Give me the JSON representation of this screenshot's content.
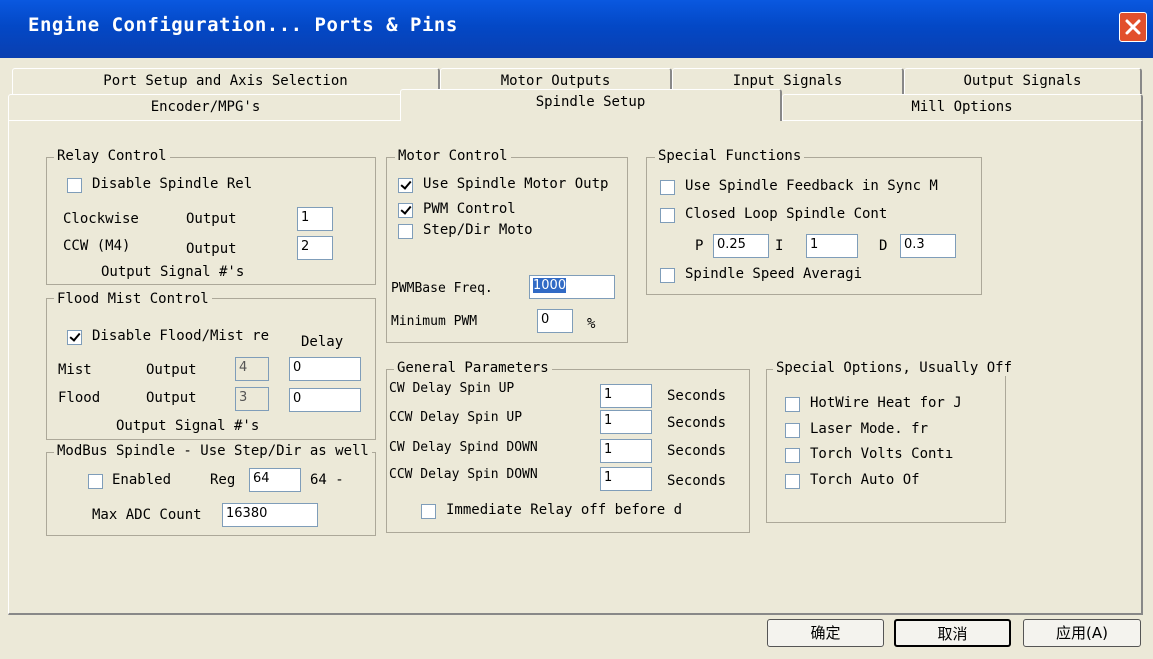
{
  "window": {
    "title": "Engine Configuration... Ports & Pins"
  },
  "tabs": {
    "row1": [
      "Port Setup and Axis Selection",
      "Motor Outputs",
      "Input Signals",
      "Output Signals"
    ],
    "row2": [
      "Encoder/MPG's",
      "Spindle Setup",
      "Mill Options"
    ],
    "active": "Spindle Setup"
  },
  "relay": {
    "title": "Relay Control",
    "disable_label": "Disable Spindle Rel",
    "cw_label": "Clockwise",
    "cw_output_label": "Output",
    "cw_value": "1",
    "ccw_label": "CCW (M4)",
    "ccw_output_label": "Output",
    "ccw_value": "2",
    "footer": "Output Signal #'s"
  },
  "flood": {
    "title": "Flood Mist Control",
    "disable_label": "Disable Flood/Mist re",
    "delay_label": "Delay",
    "mist_label": "Mist",
    "mist_output_label": "Output",
    "mist_value": "4",
    "mist_delay": "0",
    "flood_label": "Flood",
    "flood_output_label": "Output",
    "flood_value": "3",
    "flood_delay": "0",
    "footer": "Output Signal #'s"
  },
  "modbus": {
    "title": "ModBus Spindle - Use Step/Dir as well",
    "enabled_label": "Enabled",
    "reg_label": "Reg",
    "reg_value": "64",
    "reg_suffix": "64 -",
    "max_label": "Max ADC Count",
    "max_value": "16380"
  },
  "motor": {
    "title": "Motor Control",
    "use_spindle_label": "Use Spindle Motor Outp",
    "pwm_label": "PWM Control",
    "stepdir_label": "Step/Dir Moto",
    "pwm_base_label": "PWMBase Freq.",
    "pwm_base_value": "1000",
    "min_pwm_label": "Minimum PWM",
    "min_pwm_value": "0",
    "min_pwm_unit": "%"
  },
  "special": {
    "title": "Special Functions",
    "feedback_label": "Use Spindle Feedback in Sync M",
    "closed_loop_label": "Closed Loop Spindle Cont",
    "p_label": "P",
    "p_value": "0.25",
    "i_label": "I",
    "i_value": "1",
    "d_label": "D",
    "d_value": "0.3",
    "averaging_label": "Spindle Speed Averagi"
  },
  "general": {
    "title": "General Parameters",
    "rows": [
      {
        "label": "CW Delay Spin UP",
        "value": "1",
        "unit": "Seconds"
      },
      {
        "label": "CCW Delay Spin UP",
        "value": "1",
        "unit": "Seconds"
      },
      {
        "label": "CW Delay Spind DOWN",
        "value": "1",
        "unit": "Seconds"
      },
      {
        "label": "CCW Delay Spin DOWN",
        "value": "1",
        "unit": "Seconds"
      }
    ],
    "immediate_label": "Immediate Relay off before d"
  },
  "options": {
    "title": "Special Options, Usually Off",
    "items": [
      "HotWire Heat for J",
      "Laser Mode. fr",
      "Torch Volts Contı",
      "Torch Auto Of"
    ]
  },
  "buttons": {
    "ok": "确定",
    "cancel": "取消",
    "apply": "应用(A)"
  }
}
